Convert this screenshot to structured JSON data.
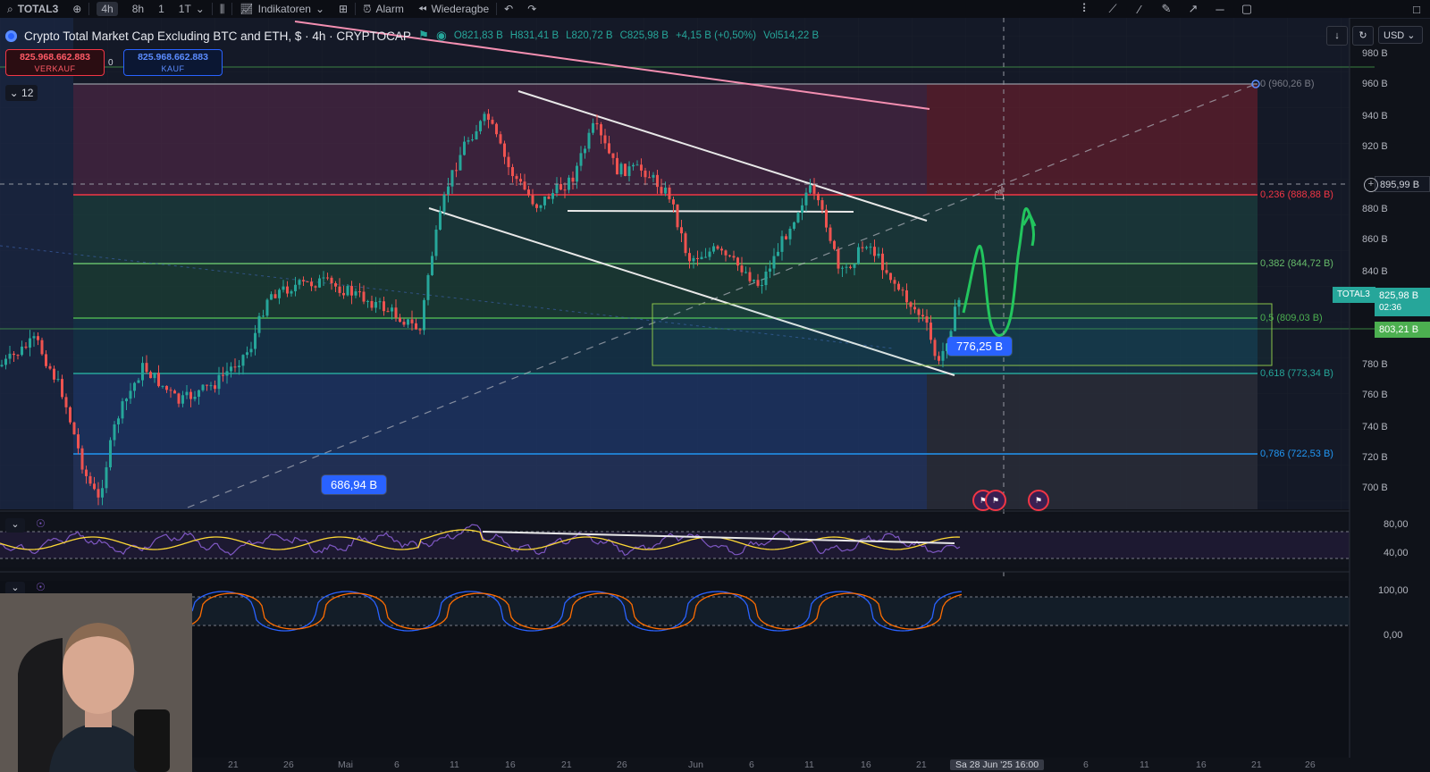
{
  "toolbar": {
    "symbol": "TOTAL3",
    "intervals": [
      "4h",
      "8h",
      "1",
      "1T"
    ],
    "indicators_label": "Indikatoren",
    "alert_label": "Alarm",
    "replay_label": "Wiederagbe"
  },
  "legend": {
    "title": "Crypto Total Market Cap Excluding BTC and ETH, $ · 4h · CRYPTOCAP",
    "open": "O821,83 B",
    "high": "H831,41 B",
    "low": "L820,72 B",
    "close": "C825,98 B",
    "change": "+4,15 B (+0,50%)",
    "volume": "Vol514,22 B"
  },
  "trade": {
    "sell_price": "825.968.662.883",
    "sell_label": "VERKAUF",
    "spread": "0",
    "buy_price": "825.968.662.883",
    "buy_label": "KAUF"
  },
  "collapse_count": "12",
  "currency": "USD",
  "price_axis": {
    "ticks": [
      "980 B",
      "960 B",
      "940 B",
      "920 B",
      "880 B",
      "860 B",
      "840 B",
      "780 B",
      "760 B",
      "740 B",
      "720 B",
      "700 B"
    ],
    "crosshair_price": "895,99 B",
    "symbol_tag": "TOTAL3",
    "current_price": "825,98 B",
    "current_countdown": "02:36",
    "green_tag": "803,21 B"
  },
  "fib_levels": [
    {
      "label": "0 (960,26 B)"
    },
    {
      "label": "0,236 (888,88 B)"
    },
    {
      "label": "0,382 (844,72 B)"
    },
    {
      "label": "0,5 (809,03 B)"
    },
    {
      "label": "0,618 (773,34 B)"
    },
    {
      "label": "0,786 (722,53 B)"
    }
  ],
  "callouts": {
    "low": "686,94 B",
    "current": "776,25 B"
  },
  "rsi_axis": [
    "80,00",
    "40,00"
  ],
  "stoch_axis": [
    "100,00",
    "0,00"
  ],
  "time_axis": [
    "21",
    "26",
    "Mai",
    "6",
    "11",
    "16",
    "21",
    "26",
    "Jun",
    "6",
    "11",
    "16",
    "21",
    "Sa 28 Jun '25 16:00",
    "6",
    "11",
    "16",
    "21",
    "26"
  ],
  "colors": {
    "background": "#0f1219",
    "up": "#26a69a",
    "down": "#ef5350",
    "fib_red": "#f23645",
    "fib_green": "#4caf50",
    "fib_teal": "#26a69a",
    "fib_blue": "#2962ff",
    "accent": "#2962ff"
  }
}
